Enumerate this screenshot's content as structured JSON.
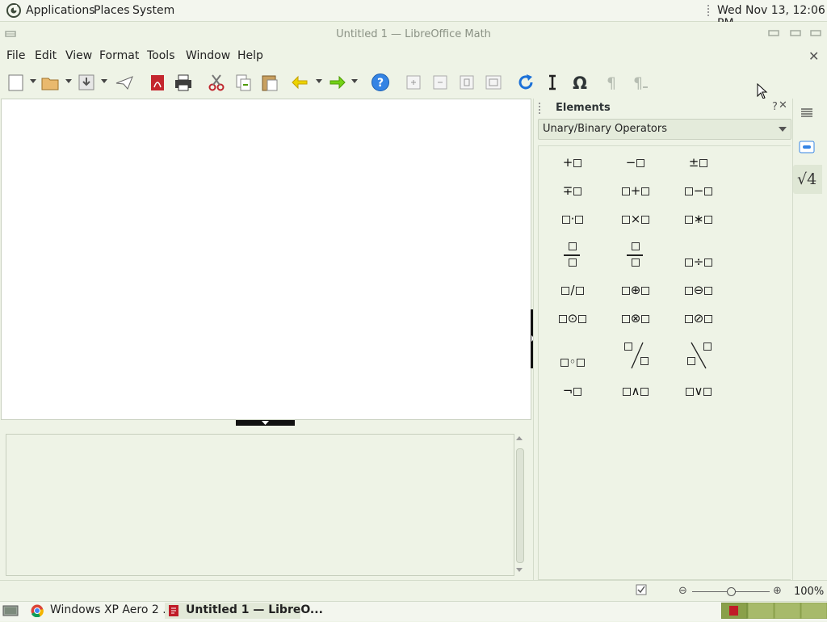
{
  "top_panel": {
    "menus": [
      "Applications",
      "Places",
      "System"
    ],
    "clock": "Wed Nov 13, 12:06 PM"
  },
  "window": {
    "title": "Untitled 1 — LibreOffice Math"
  },
  "menu_bar": [
    "File",
    "Edit",
    "View",
    "Format",
    "Tools",
    "Window",
    "Help"
  ],
  "toolbar": {
    "icons": [
      "new-icon",
      "open-icon",
      "save-icon",
      "send-icon",
      "export-pdf-icon",
      "print-icon",
      "cut-icon",
      "copy-icon",
      "paste-icon",
      "undo-icon",
      "redo-icon",
      "help-icon",
      "zoom-in-icon",
      "zoom-out-icon",
      "show-all-icon",
      "zoom-fit-icon",
      "update-icon",
      "italic-icon",
      "omega-icon",
      "formula-cursor-icon",
      "symbols-icon"
    ]
  },
  "elements": {
    "title": "Elements",
    "help": "?",
    "category": "Unary/Binary Operators",
    "symbols": [
      {
        "name": "plus"
      },
      {
        "name": "minus"
      },
      {
        "name": "plus-minus"
      },
      {
        "name": "minus-plus"
      },
      {
        "name": "addition"
      },
      {
        "name": "subtraction"
      },
      {
        "name": "multiplication-dot"
      },
      {
        "name": "multiplication-x"
      },
      {
        "name": "multiplication-star"
      },
      {
        "name": "fraction"
      },
      {
        "name": "fraction-wide"
      },
      {
        "name": "division"
      },
      {
        "name": "slash"
      },
      {
        "name": "circled-plus"
      },
      {
        "name": "circled-minus"
      },
      {
        "name": "circled-dot"
      },
      {
        "name": "circled-times"
      },
      {
        "name": "circled-slash"
      },
      {
        "name": "concatenate"
      },
      {
        "name": "wideslash"
      },
      {
        "name": "widebslash"
      },
      {
        "name": "boolean-not"
      },
      {
        "name": "boolean-and"
      },
      {
        "name": "boolean-or"
      }
    ]
  },
  "sidebar": {
    "icons": [
      "sidebar-menu-icon",
      "properties-icon",
      "elements-sqrt-icon"
    ],
    "sqrt_label": "√4"
  },
  "status_bar": {
    "zoom": "100%",
    "zoom_minus": "⊖",
    "zoom_plus": "⊕"
  },
  "taskbar": {
    "tasks": [
      "Windows XP Aero 2 ...",
      "Untitled 1 — LibreO..."
    ]
  }
}
